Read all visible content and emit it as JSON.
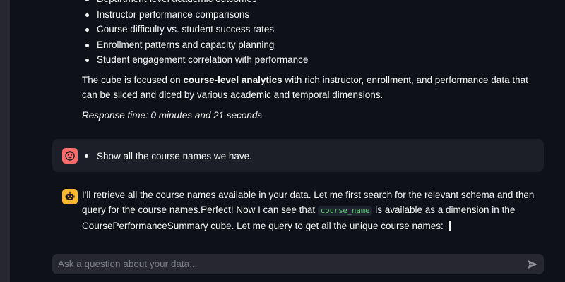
{
  "previous_response": {
    "bullets": [
      "Department-level academic outcomes",
      "Instructor performance comparisons",
      "Course difficulty vs. student success rates",
      "Enrollment patterns and capacity planning",
      "Student engagement correlation with performance"
    ],
    "summary_prefix": "The cube is focused on ",
    "summary_bold": "course-level analytics",
    "summary_suffix": " with rich instructor, enrollment, and performance data that can be sliced and diced by various academic and temporal dimensions.",
    "response_time": "Response time: 0 minutes and 21 seconds"
  },
  "user_message": {
    "text": "Show all the course names we have.",
    "avatar_icon": "smiley-face-icon",
    "avatar_color": "#ff6b6b"
  },
  "assistant_message": {
    "part1": "I'll retrieve all the course names available in your data. Let me first search for the relevant schema and then query for the course names.Perfect! Now I can see that ",
    "code": "course_name",
    "part2": " is available as a dimension in the CoursePerformanceSummary cube. Let me query to get all the unique course names:",
    "avatar_icon": "robot-icon",
    "avatar_color": "#f7b731"
  },
  "chat_input": {
    "placeholder": "Ask a question about your data...",
    "value": "",
    "send_icon": "send-arrow-icon"
  }
}
